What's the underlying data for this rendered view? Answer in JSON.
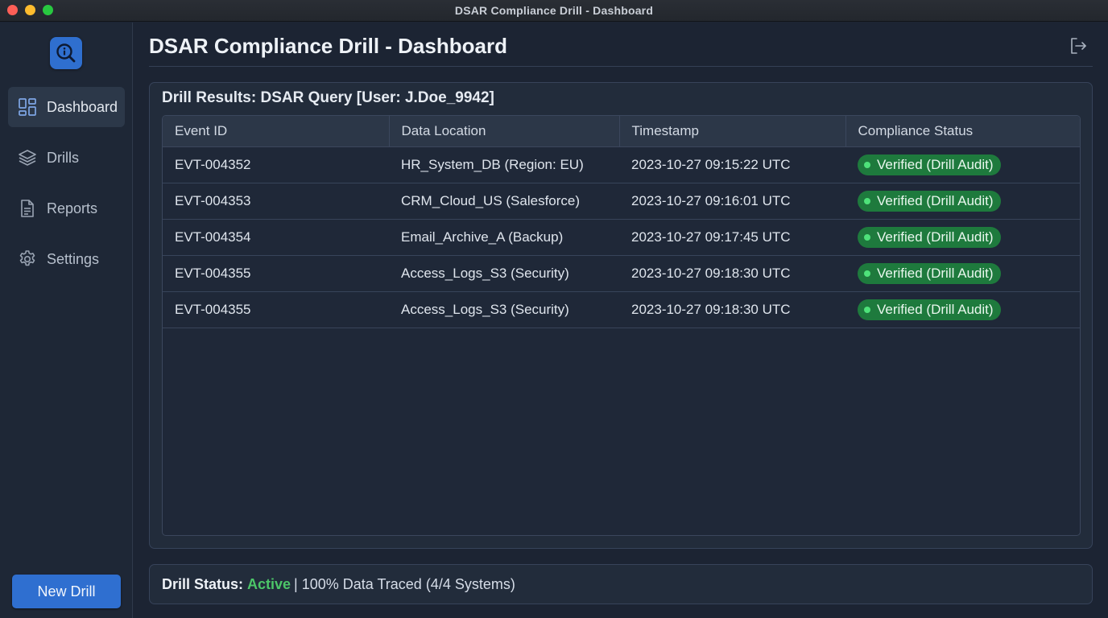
{
  "window": {
    "title": "DSAR Compliance Drill - Dashboard"
  },
  "sidebar": {
    "items": [
      {
        "label": "Dashboard",
        "icon": "dashboard-icon",
        "active": true
      },
      {
        "label": "Drills",
        "icon": "layers-icon",
        "active": false
      },
      {
        "label": "Reports",
        "icon": "document-icon",
        "active": false
      },
      {
        "label": "Settings",
        "icon": "gear-icon",
        "active": false
      }
    ],
    "new_drill_label": "New Drill"
  },
  "header": {
    "title": "DSAR Compliance Drill - Dashboard"
  },
  "results": {
    "title": "Drill Results: DSAR Query [User: J.Doe_9942]",
    "columns": [
      "Event ID",
      "Data Location",
      "Timestamp",
      "Compliance Status"
    ],
    "rows": [
      {
        "event_id": "EVT-004352",
        "location": "HR_System_DB (Region: EU)",
        "timestamp": "2023-10-27 09:15:22 UTC",
        "status": "Verified (Drill Audit)"
      },
      {
        "event_id": "EVT-004353",
        "location": "CRM_Cloud_US (Salesforce)",
        "timestamp": "2023-10-27 09:16:01 UTC",
        "status": "Verified (Drill Audit)"
      },
      {
        "event_id": "EVT-004354",
        "location": "Email_Archive_A (Backup)",
        "timestamp": "2023-10-27 09:17:45 UTC",
        "status": "Verified (Drill Audit)"
      },
      {
        "event_id": "EVT-004355",
        "location": "Access_Logs_S3 (Security)",
        "timestamp": "2023-10-27 09:18:30 UTC",
        "status": "Verified (Drill Audit)"
      },
      {
        "event_id": "EVT-004355",
        "location": "Access_Logs_S3 (Security)",
        "timestamp": "2023-10-27 09:18:30 UTC",
        "status": "Verified (Drill Audit)"
      }
    ]
  },
  "status_bar": {
    "label": "Drill Status:",
    "state": "Active",
    "detail": "| 100% Data Traced (4/4 Systems)"
  },
  "colors": {
    "accent": "#2f6fd0",
    "success": "#4cc668",
    "badge_bg": "#1e7a3d"
  }
}
